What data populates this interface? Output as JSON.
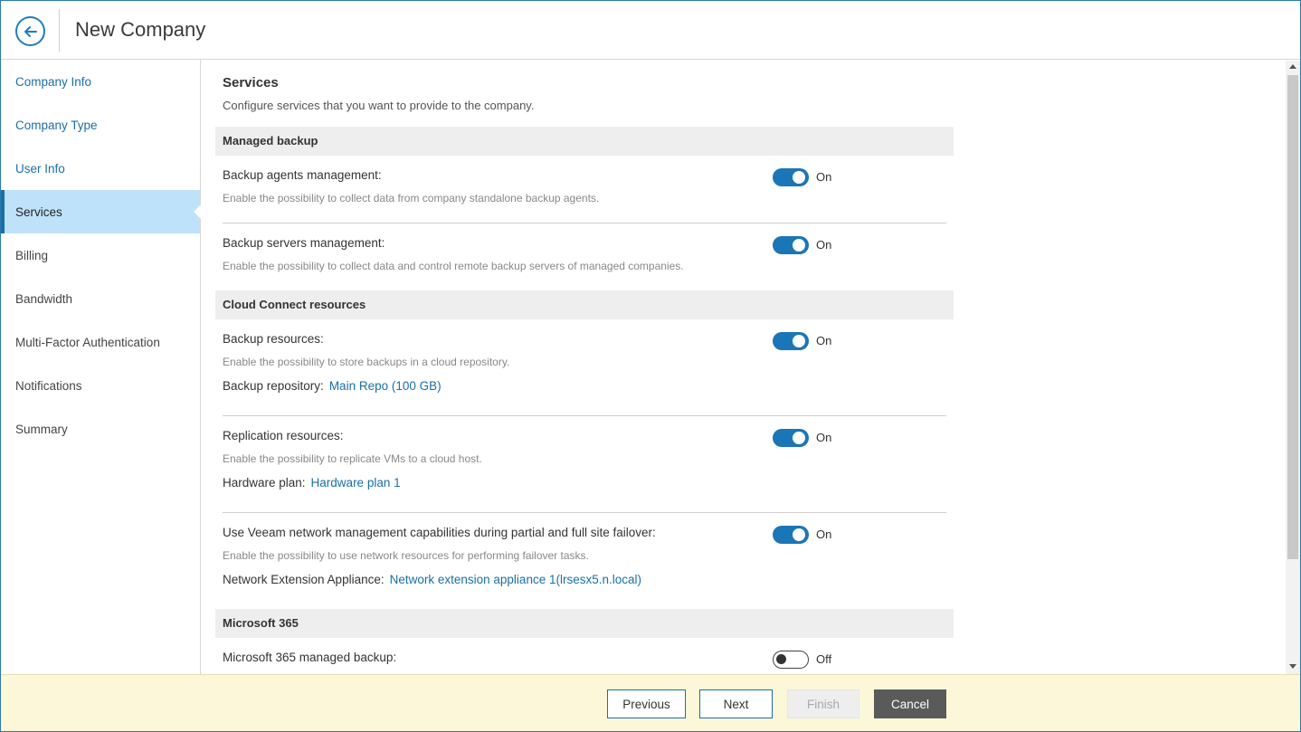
{
  "header": {
    "title": "New Company"
  },
  "sidebar": {
    "items": [
      {
        "label": "Company Info"
      },
      {
        "label": "Company Type"
      },
      {
        "label": "User Info"
      },
      {
        "label": "Services"
      },
      {
        "label": "Billing"
      },
      {
        "label": "Bandwidth"
      },
      {
        "label": "Multi-Factor Authentication"
      },
      {
        "label": "Notifications"
      },
      {
        "label": "Summary"
      }
    ],
    "active": "Services"
  },
  "main": {
    "title": "Services",
    "description": "Configure services that you want to provide to the company.",
    "groups": {
      "managed_backup": "Managed backup",
      "cloud_connect": "Cloud Connect resources",
      "m365": "Microsoft 365"
    },
    "options": {
      "backup_agents": {
        "label": "Backup agents management:",
        "desc": "Enable the possibility to collect data from company standalone backup agents.",
        "state": "On"
      },
      "backup_servers": {
        "label": "Backup servers management:",
        "desc": "Enable the possibility to collect data and control remote backup servers of managed companies.",
        "state": "On"
      },
      "backup_resources": {
        "label": "Backup resources:",
        "desc": "Enable the possibility to store backups in a cloud repository.",
        "state": "On",
        "sub_label": "Backup repository:",
        "sub_link": "Main Repo (100 GB)"
      },
      "replication_resources": {
        "label": "Replication resources:",
        "desc": "Enable the possibility to replicate VMs to a cloud host.",
        "state": "On",
        "sub_label": "Hardware plan:",
        "sub_link": "Hardware plan 1"
      },
      "network_mgmt": {
        "label": "Use Veeam network management capabilities during partial and full site failover:",
        "desc": "Enable the possibility to use network resources for performing failover tasks.",
        "state": "On",
        "sub_label": "Network Extension Appliance:",
        "sub_link": "Network extension appliance 1(lrsesx5.n.local)"
      },
      "m365_backup": {
        "label": "Microsoft 365 managed backup:",
        "state": "Off"
      }
    }
  },
  "footer": {
    "previous": "Previous",
    "next": "Next",
    "finish": "Finish",
    "cancel": "Cancel"
  },
  "colors": {
    "accent": "#1a76b6",
    "active_nav_bg": "#bfe2fb",
    "footer_bg": "#fcf7d9"
  }
}
